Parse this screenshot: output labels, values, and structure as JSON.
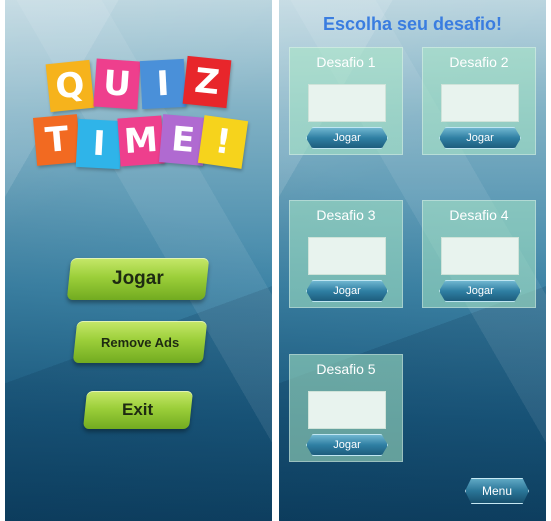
{
  "logo": {
    "row1": [
      "Q",
      "U",
      "I",
      "Z"
    ],
    "row2": [
      "T",
      "I",
      "M",
      "E",
      "!"
    ],
    "colors": {
      "row1": [
        "#f6b31c",
        "#ee3f8d",
        "#4a90d9",
        "#e8262b"
      ],
      "row2": [
        "#f26a21",
        "#2fb4e9",
        "#ee3f8d",
        "#b06ad1",
        "#f6d31c"
      ]
    }
  },
  "main_menu": {
    "play_label": "Jogar",
    "remove_ads_label": "Remove Ads",
    "exit_label": "Exit"
  },
  "challenges": {
    "title": "Escolha seu desafio!",
    "items": [
      {
        "label": "Desafio 1",
        "button": "Jogar"
      },
      {
        "label": "Desafio 2",
        "button": "Jogar"
      },
      {
        "label": "Desafio 3",
        "button": "Jogar"
      },
      {
        "label": "Desafio 4",
        "button": "Jogar"
      },
      {
        "label": "Desafio 5",
        "button": "Jogar"
      }
    ],
    "menu_label": "Menu"
  }
}
